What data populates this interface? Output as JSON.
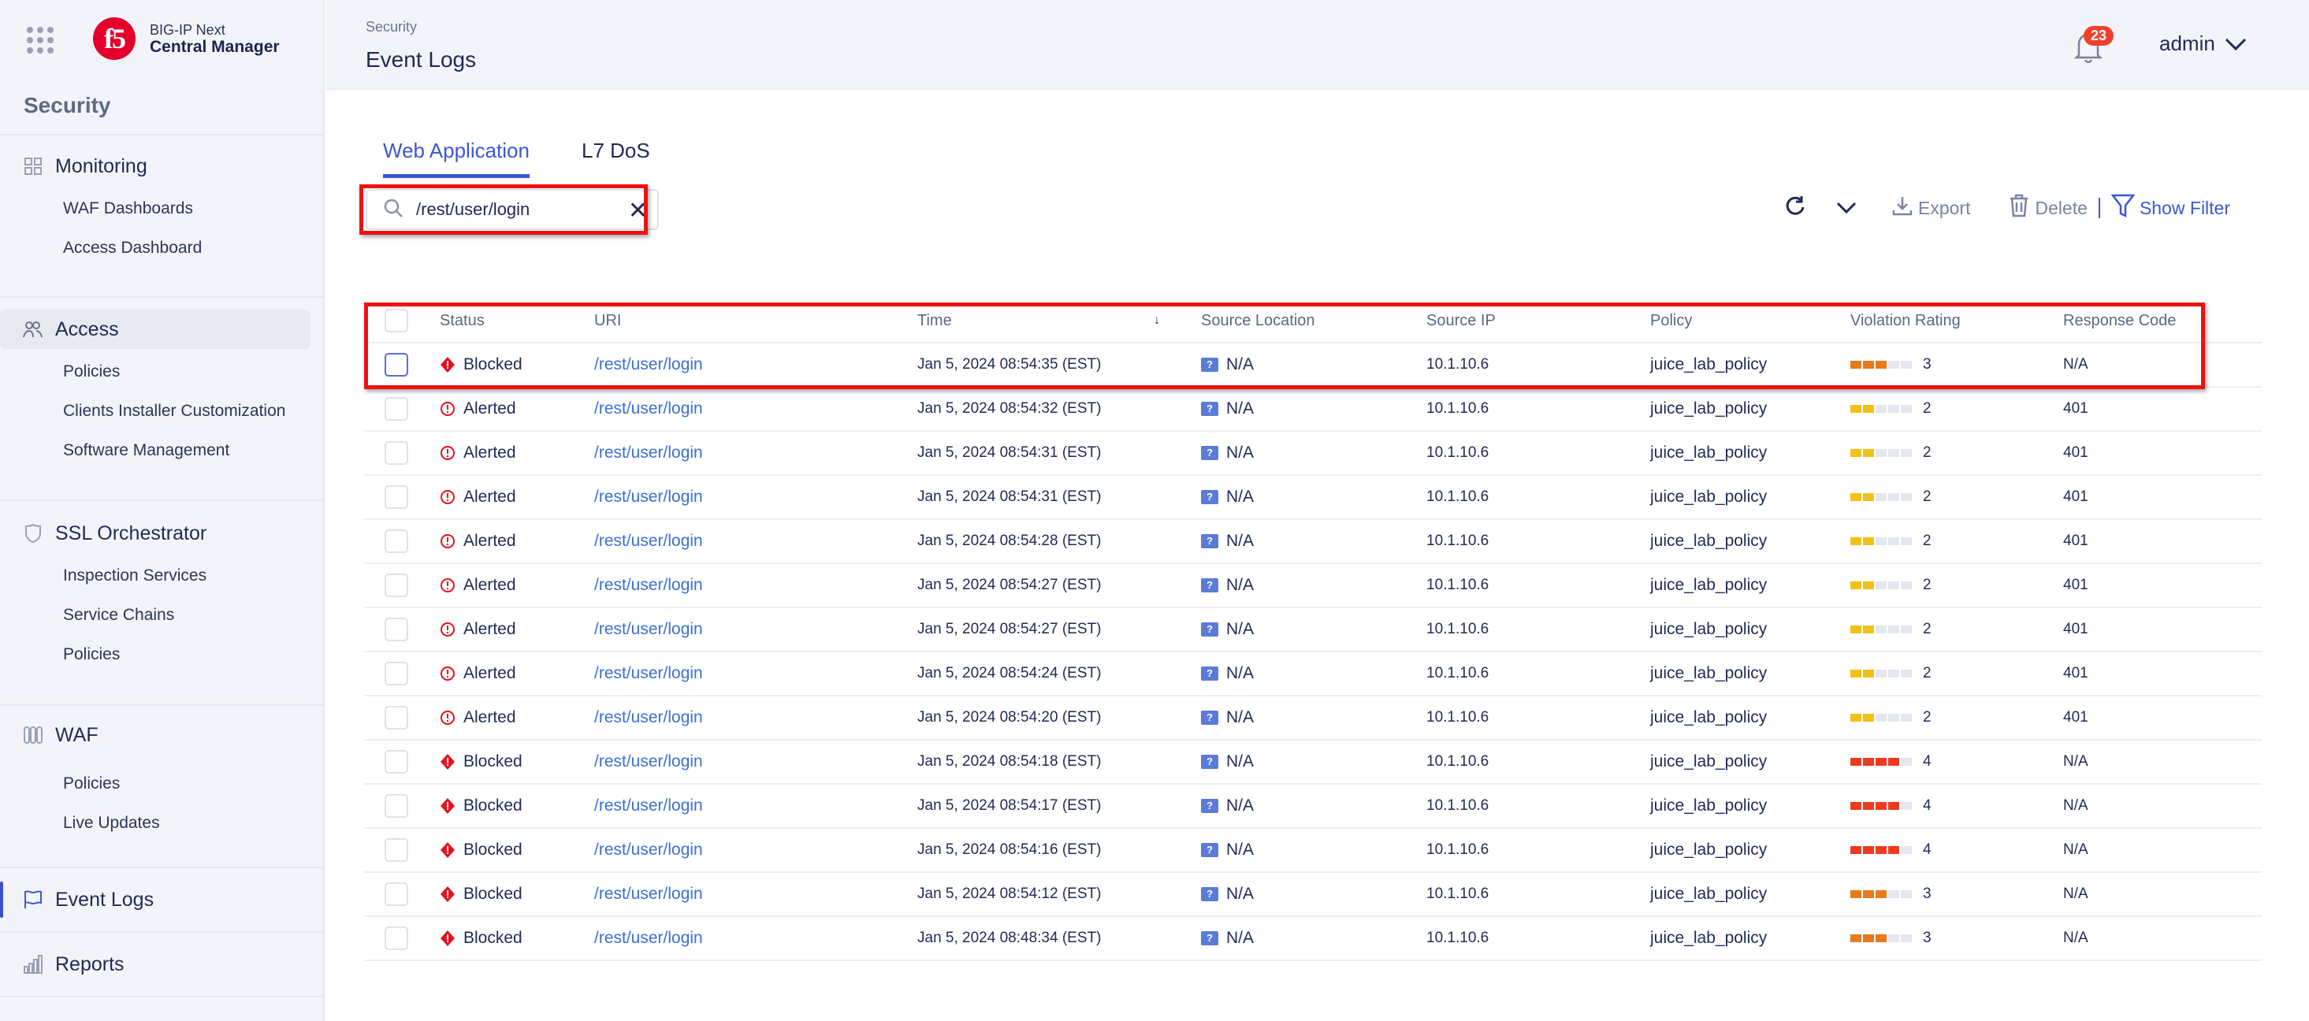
{
  "brand": {
    "line1": "BIG-IP Next",
    "line2": "Central Manager",
    "logo_text": "f5"
  },
  "sidebar": {
    "section_title": "Security",
    "groups": [
      {
        "label": "Monitoring",
        "icon": "grid-icon",
        "items": [
          "WAF Dashboards",
          "Access Dashboard"
        ]
      },
      {
        "label": "Access",
        "icon": "users-icon",
        "items": [
          "Policies",
          "Clients Installer Customization",
          "Software Management"
        ]
      },
      {
        "label": "SSL Orchestrator",
        "icon": "shield-icon",
        "items": [
          "Inspection Services",
          "Service Chains",
          "Policies"
        ]
      },
      {
        "label": "WAF",
        "icon": "waf-icon",
        "items": [
          "Policies",
          "Live Updates"
        ]
      },
      {
        "label": "Event Logs",
        "icon": "flag-icon",
        "items": []
      },
      {
        "label": "Reports",
        "icon": "bar-chart-icon",
        "items": []
      }
    ]
  },
  "header": {
    "breadcrumb": "Security",
    "title": "Event Logs",
    "notification_count": "23",
    "user": "admin"
  },
  "tabs": [
    {
      "label": "Web Application",
      "active": true
    },
    {
      "label": "L7 DoS",
      "active": false
    }
  ],
  "search": {
    "value": "/rest/user/login",
    "placeholder": "Search"
  },
  "toolbar": {
    "export": "Export",
    "delete": "Delete",
    "show_filter": "Show Filter"
  },
  "colors": {
    "accent": "#3b57d6",
    "blocked": "#e5121e",
    "alerted": "#e5121e",
    "rating4": "#f2391f",
    "rating3": "#e8791c",
    "rating2": "#f3c016",
    "highlight_box": "#ee1111"
  },
  "table": {
    "columns": [
      "Status",
      "URI",
      "Time",
      "Source Location",
      "Source IP",
      "Policy",
      "Violation Rating",
      "Response Code"
    ],
    "sort_indicator": "↓",
    "rows": [
      {
        "status": "Blocked",
        "uri": "/rest/user/login",
        "time": "Jan 5, 2024 08:54:35 (EST)",
        "location": "N/A",
        "ip": "10.1.10.6",
        "policy": "juice_lab_policy",
        "rating": 3,
        "rating_label": "3",
        "response": "N/A"
      },
      {
        "status": "Alerted",
        "uri": "/rest/user/login",
        "time": "Jan 5, 2024 08:54:32 (EST)",
        "location": "N/A",
        "ip": "10.1.10.6",
        "policy": "juice_lab_policy",
        "rating": 2,
        "rating_label": "2",
        "response": "401"
      },
      {
        "status": "Alerted",
        "uri": "/rest/user/login",
        "time": "Jan 5, 2024 08:54:31 (EST)",
        "location": "N/A",
        "ip": "10.1.10.6",
        "policy": "juice_lab_policy",
        "rating": 2,
        "rating_label": "2",
        "response": "401"
      },
      {
        "status": "Alerted",
        "uri": "/rest/user/login",
        "time": "Jan 5, 2024 08:54:31 (EST)",
        "location": "N/A",
        "ip": "10.1.10.6",
        "policy": "juice_lab_policy",
        "rating": 2,
        "rating_label": "2",
        "response": "401"
      },
      {
        "status": "Alerted",
        "uri": "/rest/user/login",
        "time": "Jan 5, 2024 08:54:28 (EST)",
        "location": "N/A",
        "ip": "10.1.10.6",
        "policy": "juice_lab_policy",
        "rating": 2,
        "rating_label": "2",
        "response": "401"
      },
      {
        "status": "Alerted",
        "uri": "/rest/user/login",
        "time": "Jan 5, 2024 08:54:27 (EST)",
        "location": "N/A",
        "ip": "10.1.10.6",
        "policy": "juice_lab_policy",
        "rating": 2,
        "rating_label": "2",
        "response": "401"
      },
      {
        "status": "Alerted",
        "uri": "/rest/user/login",
        "time": "Jan 5, 2024 08:54:27 (EST)",
        "location": "N/A",
        "ip": "10.1.10.6",
        "policy": "juice_lab_policy",
        "rating": 2,
        "rating_label": "2",
        "response": "401"
      },
      {
        "status": "Alerted",
        "uri": "/rest/user/login",
        "time": "Jan 5, 2024 08:54:24 (EST)",
        "location": "N/A",
        "ip": "10.1.10.6",
        "policy": "juice_lab_policy",
        "rating": 2,
        "rating_label": "2",
        "response": "401"
      },
      {
        "status": "Alerted",
        "uri": "/rest/user/login",
        "time": "Jan 5, 2024 08:54:20 (EST)",
        "location": "N/A",
        "ip": "10.1.10.6",
        "policy": "juice_lab_policy",
        "rating": 2,
        "rating_label": "2",
        "response": "401"
      },
      {
        "status": "Blocked",
        "uri": "/rest/user/login",
        "time": "Jan 5, 2024 08:54:18 (EST)",
        "location": "N/A",
        "ip": "10.1.10.6",
        "policy": "juice_lab_policy",
        "rating": 4,
        "rating_label": "4",
        "response": "N/A"
      },
      {
        "status": "Blocked",
        "uri": "/rest/user/login",
        "time": "Jan 5, 2024 08:54:17 (EST)",
        "location": "N/A",
        "ip": "10.1.10.6",
        "policy": "juice_lab_policy",
        "rating": 4,
        "rating_label": "4",
        "response": "N/A"
      },
      {
        "status": "Blocked",
        "uri": "/rest/user/login",
        "time": "Jan 5, 2024 08:54:16 (EST)",
        "location": "N/A",
        "ip": "10.1.10.6",
        "policy": "juice_lab_policy",
        "rating": 4,
        "rating_label": "4",
        "response": "N/A"
      },
      {
        "status": "Blocked",
        "uri": "/rest/user/login",
        "time": "Jan 5, 2024 08:54:12 (EST)",
        "location": "N/A",
        "ip": "10.1.10.6",
        "policy": "juice_lab_policy",
        "rating": 3,
        "rating_label": "3",
        "response": "N/A"
      },
      {
        "status": "Blocked",
        "uri": "/rest/user/login",
        "time": "Jan 5, 2024 08:48:34 (EST)",
        "location": "N/A",
        "ip": "10.1.10.6",
        "policy": "juice_lab_policy",
        "rating": 3,
        "rating_label": "3",
        "response": "N/A"
      }
    ]
  }
}
